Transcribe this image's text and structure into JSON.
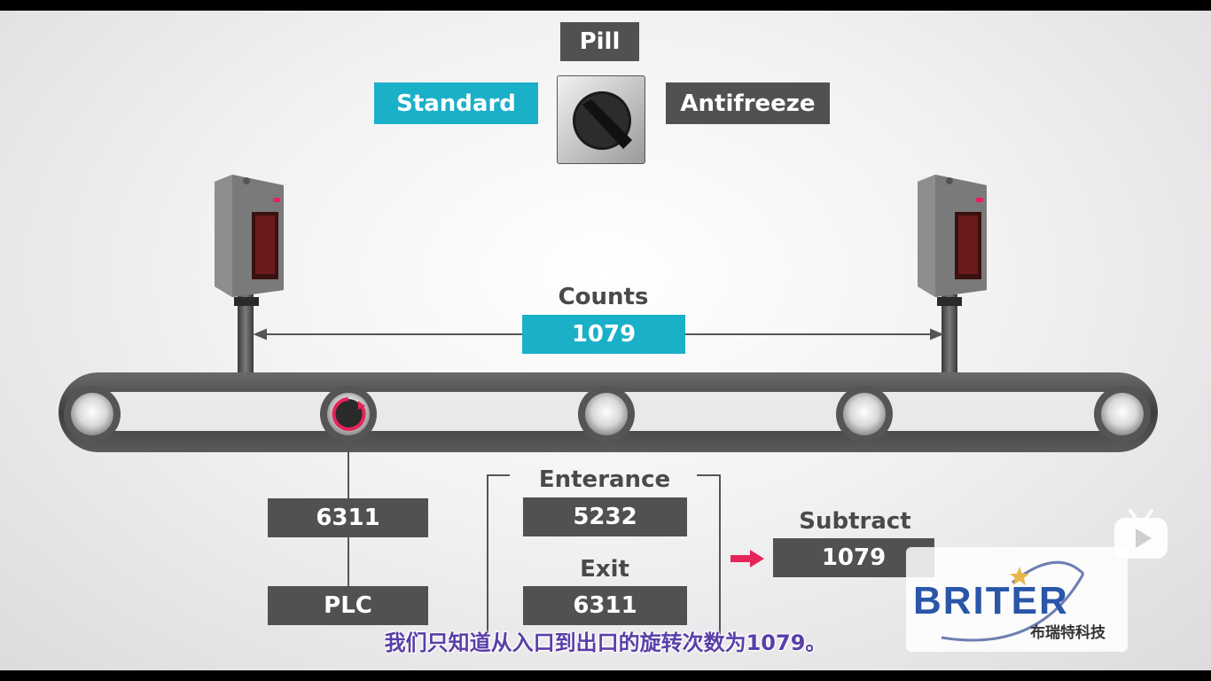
{
  "selector": {
    "title": "Pill",
    "left_option": "Standard",
    "right_option": "Antifreeze"
  },
  "counts": {
    "caption": "Counts",
    "value": "1079"
  },
  "left_counter": {
    "value": "6311",
    "plc_label": "PLC"
  },
  "entrance": {
    "caption": "Enterance",
    "value": "5232"
  },
  "exit": {
    "caption": "Exit",
    "value": "6311"
  },
  "subtract": {
    "caption": "Subtract",
    "value": "1079"
  },
  "watermark": {
    "brand": "BRITER",
    "brand_cn": "布瑞特科技"
  },
  "subtitle": "我们只知道从入口到出口的旋转次数为1079。",
  "colors": {
    "teal": "#1ab0c8",
    "dark_box": "#505152",
    "arrow_red": "#e6245a",
    "subtitle": "#5a3fa8",
    "brand_blue": "#2a56a8"
  }
}
